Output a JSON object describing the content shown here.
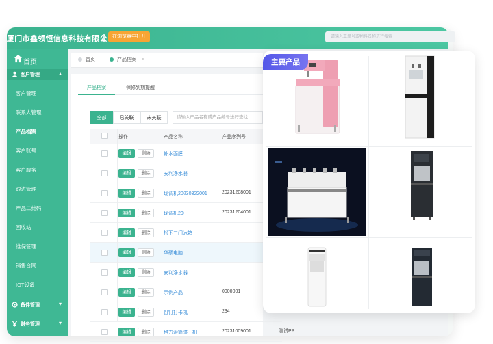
{
  "header": {
    "company_name": "厦门市鑫领恒信息科技有限公司",
    "open_button_label": "在浏览器中打开",
    "search_placeholder": "请输入工单号或物料名称进行搜索"
  },
  "sidebar": {
    "home_label": "首页",
    "groups": [
      {
        "label": "客户管理",
        "chevron": "▴"
      },
      {
        "label": "备件管理",
        "chevron": "▾"
      },
      {
        "label": "财务管理",
        "chevron": "▾"
      }
    ],
    "items": [
      {
        "label": "客户管理"
      },
      {
        "label": "联系人管理"
      },
      {
        "label": "产品档案"
      },
      {
        "label": "客户账号"
      },
      {
        "label": "客户服务"
      },
      {
        "label": "跟进管理"
      },
      {
        "label": "产品二维码"
      },
      {
        "label": "回收站"
      },
      {
        "label": "维保管理"
      },
      {
        "label": "销售合同"
      },
      {
        "label": "IOT设备"
      }
    ],
    "active_item": "产品档案"
  },
  "tabs": [
    {
      "label": "首页"
    },
    {
      "label": "产品档案",
      "close": "×"
    }
  ],
  "subtabs": [
    {
      "label": "产品档案"
    },
    {
      "label": "保修到期提醒"
    }
  ],
  "filters": {
    "buttons": [
      "全部",
      "已关联",
      "未关联"
    ],
    "search_placeholder": "请输入产品名称或产品编号进行查找"
  },
  "table": {
    "headers": [
      "操作",
      "产品名称",
      "产品序列号"
    ],
    "edit_label": "编辑",
    "delete_label": "删除",
    "rows": [
      {
        "name": "补水面膜",
        "serial": ""
      },
      {
        "name": "安利净水器",
        "serial": ""
      },
      {
        "name": "现调机20230322001",
        "serial": "20231208001"
      },
      {
        "name": "现调机20",
        "serial": "20231204001"
      },
      {
        "name": "松下三门冰箱",
        "serial": ""
      },
      {
        "name": "华硕电脑",
        "serial": ""
      },
      {
        "name": "安利净水器",
        "serial": ""
      },
      {
        "name": "示例产品",
        "serial": "0000001"
      },
      {
        "name": "钉钉打卡机",
        "serial": "234"
      },
      {
        "name": "格力滚筒烘干机",
        "serial": "20231009001"
      }
    ],
    "extra_cell": "测试PP"
  },
  "products_panel": {
    "badge": "主要产品",
    "images": [
      {
        "icon": "pink-water-dispenser-image"
      },
      {
        "icon": "white-black-water-dispenser-image"
      },
      {
        "icon": "multi-tap-water-boiler-image"
      },
      {
        "icon": "black-water-dispenser-image"
      },
      {
        "icon": "white-water-purifier-image"
      },
      {
        "icon": "dark-water-dispenser-image"
      }
    ]
  },
  "colors": {
    "brand_green": "#3bb38f",
    "badge_purple": "#5a5ae8",
    "link_blue": "#3a8ed8",
    "open_button_orange": "#f7a534"
  }
}
